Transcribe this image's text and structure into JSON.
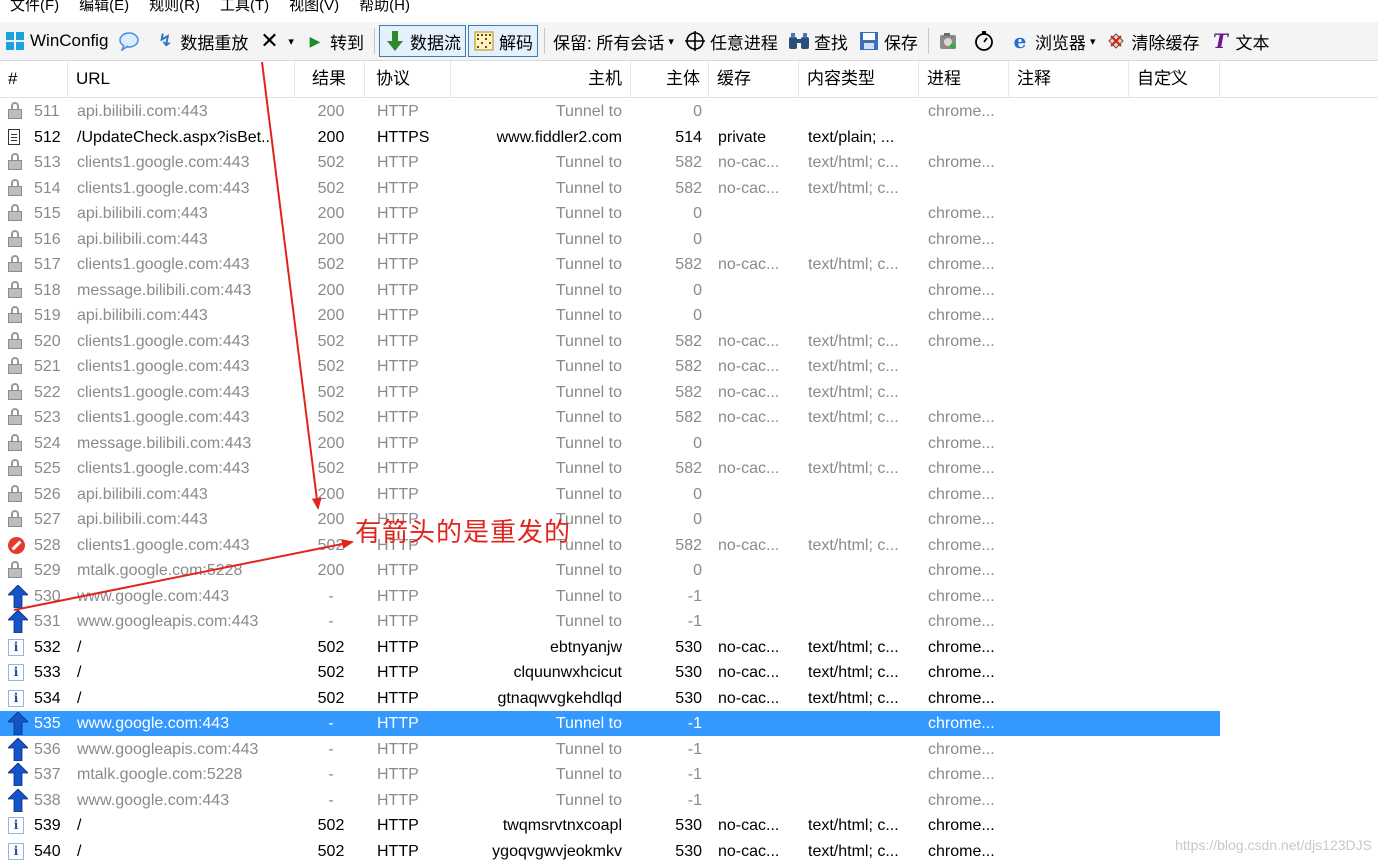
{
  "menu": [
    "文件(F)",
    "编辑(E)",
    "规则(R)",
    "工具(T)",
    "视图(V)",
    "帮助(H)"
  ],
  "toolbar": {
    "winconfig": "WinConfig",
    "replay": "数据重放",
    "goto": "转到",
    "stream": "数据流",
    "decode": "解码",
    "keep": "保留: 所有会话",
    "any_process": "任意进程",
    "find": "查找",
    "save": "保存",
    "browser": "浏览器",
    "clear_cache": "清除缓存",
    "text": "文本"
  },
  "columns": {
    "num": "#",
    "url": "URL",
    "result": "结果",
    "protocol": "协议",
    "host": "主机",
    "body": "主体",
    "caching": "缓存",
    "content_type": "内容类型",
    "process": "进程",
    "comments": "注释",
    "custom": "自定义"
  },
  "rows": [
    {
      "icon": "lock",
      "num": "511",
      "url": "api.bilibili.com:443",
      "result": "200",
      "protocol": "HTTP",
      "host": "Tunnel to",
      "body": "0",
      "caching": "",
      "content_type": "",
      "process": "chrome...",
      "style": "dim"
    },
    {
      "icon": "doc",
      "num": "512",
      "url": "/UpdateCheck.aspx?isBet...",
      "result": "200",
      "protocol": "HTTPS",
      "host": "www.fiddler2.com",
      "body": "514",
      "caching": "private",
      "content_type": "text/plain; ...",
      "process": "",
      "style": "normal"
    },
    {
      "icon": "lock",
      "num": "513",
      "url": "clients1.google.com:443",
      "result": "502",
      "protocol": "HTTP",
      "host": "Tunnel to",
      "body": "582",
      "caching": "no-cac...",
      "content_type": "text/html; c...",
      "process": "chrome...",
      "style": "dim"
    },
    {
      "icon": "lock",
      "num": "514",
      "url": "clients1.google.com:443",
      "result": "502",
      "protocol": "HTTP",
      "host": "Tunnel to",
      "body": "582",
      "caching": "no-cac...",
      "content_type": "text/html; c...",
      "process": "",
      "style": "dim"
    },
    {
      "icon": "lock",
      "num": "515",
      "url": "api.bilibili.com:443",
      "result": "200",
      "protocol": "HTTP",
      "host": "Tunnel to",
      "body": "0",
      "caching": "",
      "content_type": "",
      "process": "chrome...",
      "style": "dim"
    },
    {
      "icon": "lock",
      "num": "516",
      "url": "api.bilibili.com:443",
      "result": "200",
      "protocol": "HTTP",
      "host": "Tunnel to",
      "body": "0",
      "caching": "",
      "content_type": "",
      "process": "chrome...",
      "style": "dim"
    },
    {
      "icon": "lock",
      "num": "517",
      "url": "clients1.google.com:443",
      "result": "502",
      "protocol": "HTTP",
      "host": "Tunnel to",
      "body": "582",
      "caching": "no-cac...",
      "content_type": "text/html; c...",
      "process": "chrome...",
      "style": "dim"
    },
    {
      "icon": "lock",
      "num": "518",
      "url": "message.bilibili.com:443",
      "result": "200",
      "protocol": "HTTP",
      "host": "Tunnel to",
      "body": "0",
      "caching": "",
      "content_type": "",
      "process": "chrome...",
      "style": "dim"
    },
    {
      "icon": "lock",
      "num": "519",
      "url": "api.bilibili.com:443",
      "result": "200",
      "protocol": "HTTP",
      "host": "Tunnel to",
      "body": "0",
      "caching": "",
      "content_type": "",
      "process": "chrome...",
      "style": "dim"
    },
    {
      "icon": "lock",
      "num": "520",
      "url": "clients1.google.com:443",
      "result": "502",
      "protocol": "HTTP",
      "host": "Tunnel to",
      "body": "582",
      "caching": "no-cac...",
      "content_type": "text/html; c...",
      "process": "chrome...",
      "style": "dim"
    },
    {
      "icon": "lock",
      "num": "521",
      "url": "clients1.google.com:443",
      "result": "502",
      "protocol": "HTTP",
      "host": "Tunnel to",
      "body": "582",
      "caching": "no-cac...",
      "content_type": "text/html; c...",
      "process": "",
      "style": "dim"
    },
    {
      "icon": "lock",
      "num": "522",
      "url": "clients1.google.com:443",
      "result": "502",
      "protocol": "HTTP",
      "host": "Tunnel to",
      "body": "582",
      "caching": "no-cac...",
      "content_type": "text/html; c...",
      "process": "",
      "style": "dim"
    },
    {
      "icon": "lock",
      "num": "523",
      "url": "clients1.google.com:443",
      "result": "502",
      "protocol": "HTTP",
      "host": "Tunnel to",
      "body": "582",
      "caching": "no-cac...",
      "content_type": "text/html; c...",
      "process": "chrome...",
      "style": "dim"
    },
    {
      "icon": "lock",
      "num": "524",
      "url": "message.bilibili.com:443",
      "result": "200",
      "protocol": "HTTP",
      "host": "Tunnel to",
      "body": "0",
      "caching": "",
      "content_type": "",
      "process": "chrome...",
      "style": "dim"
    },
    {
      "icon": "lock",
      "num": "525",
      "url": "clients1.google.com:443",
      "result": "502",
      "protocol": "HTTP",
      "host": "Tunnel to",
      "body": "582",
      "caching": "no-cac...",
      "content_type": "text/html; c...",
      "process": "chrome...",
      "style": "dim"
    },
    {
      "icon": "lock",
      "num": "526",
      "url": "api.bilibili.com:443",
      "result": "200",
      "protocol": "HTTP",
      "host": "Tunnel to",
      "body": "0",
      "caching": "",
      "content_type": "",
      "process": "chrome...",
      "style": "dim"
    },
    {
      "icon": "lock",
      "num": "527",
      "url": "api.bilibili.com:443",
      "result": "200",
      "protocol": "HTTP",
      "host": "Tunnel to",
      "body": "0",
      "caching": "",
      "content_type": "",
      "process": "chrome...",
      "style": "dim"
    },
    {
      "icon": "blocked",
      "num": "528",
      "url": "clients1.google.com:443",
      "result": "502",
      "protocol": "HTTP",
      "host": "Tunnel to",
      "body": "582",
      "caching": "no-cac...",
      "content_type": "text/html; c...",
      "process": "chrome...",
      "style": "dim"
    },
    {
      "icon": "lock",
      "num": "529",
      "url": "mtalk.google.com:5228",
      "result": "200",
      "protocol": "HTTP",
      "host": "Tunnel to",
      "body": "0",
      "caching": "",
      "content_type": "",
      "process": "chrome...",
      "style": "dim"
    },
    {
      "icon": "up",
      "num": "530",
      "url": "www.google.com:443",
      "result": "-",
      "protocol": "HTTP",
      "host": "Tunnel to",
      "body": "-1",
      "caching": "",
      "content_type": "",
      "process": "chrome...",
      "style": "dim"
    },
    {
      "icon": "up",
      "num": "531",
      "url": "www.googleapis.com:443",
      "result": "-",
      "protocol": "HTTP",
      "host": "Tunnel to",
      "body": "-1",
      "caching": "",
      "content_type": "",
      "process": "chrome...",
      "style": "dim"
    },
    {
      "icon": "info",
      "num": "532",
      "url": "/",
      "result": "502",
      "protocol": "HTTP",
      "host": "ebtnyanjw",
      "body": "530",
      "caching": "no-cac...",
      "content_type": "text/html; c...",
      "process": "chrome...",
      "style": "normal"
    },
    {
      "icon": "info",
      "num": "533",
      "url": "/",
      "result": "502",
      "protocol": "HTTP",
      "host": "clquunwxhcicut",
      "body": "530",
      "caching": "no-cac...",
      "content_type": "text/html; c...",
      "process": "chrome...",
      "style": "normal"
    },
    {
      "icon": "info",
      "num": "534",
      "url": "/",
      "result": "502",
      "protocol": "HTTP",
      "host": "gtnaqwvgkehdlqd",
      "body": "530",
      "caching": "no-cac...",
      "content_type": "text/html; c...",
      "process": "chrome...",
      "style": "normal"
    },
    {
      "icon": "up",
      "num": "535",
      "url": "www.google.com:443",
      "result": "-",
      "protocol": "HTTP",
      "host": "Tunnel to",
      "body": "-1",
      "caching": "",
      "content_type": "",
      "process": "chrome...",
      "style": "selected"
    },
    {
      "icon": "up",
      "num": "536",
      "url": "www.googleapis.com:443",
      "result": "-",
      "protocol": "HTTP",
      "host": "Tunnel to",
      "body": "-1",
      "caching": "",
      "content_type": "",
      "process": "chrome...",
      "style": "dim"
    },
    {
      "icon": "up",
      "num": "537",
      "url": "mtalk.google.com:5228",
      "result": "-",
      "protocol": "HTTP",
      "host": "Tunnel to",
      "body": "-1",
      "caching": "",
      "content_type": "",
      "process": "chrome...",
      "style": "dim"
    },
    {
      "icon": "up",
      "num": "538",
      "url": "www.google.com:443",
      "result": "-",
      "protocol": "HTTP",
      "host": "Tunnel to",
      "body": "-1",
      "caching": "",
      "content_type": "",
      "process": "chrome...",
      "style": "dim"
    },
    {
      "icon": "info",
      "num": "539",
      "url": "/",
      "result": "502",
      "protocol": "HTTP",
      "host": "twqmsrvtnxcoapl",
      "body": "530",
      "caching": "no-cac...",
      "content_type": "text/html; c...",
      "process": "chrome...",
      "style": "normal"
    },
    {
      "icon": "info",
      "num": "540",
      "url": "/",
      "result": "502",
      "protocol": "HTTP",
      "host": "ygoqvgwvjeokmkv",
      "body": "530",
      "caching": "no-cac...",
      "content_type": "text/html; c...",
      "process": "chrome...",
      "style": "normal"
    }
  ],
  "annotation": {
    "text": "有箭头的是重发的",
    "color": "#e0251c"
  },
  "watermark": "https://blog.csdn.net/djs123DJS",
  "colors": {
    "selection": "#3399ff",
    "arrow_blue": "#1553c8"
  }
}
